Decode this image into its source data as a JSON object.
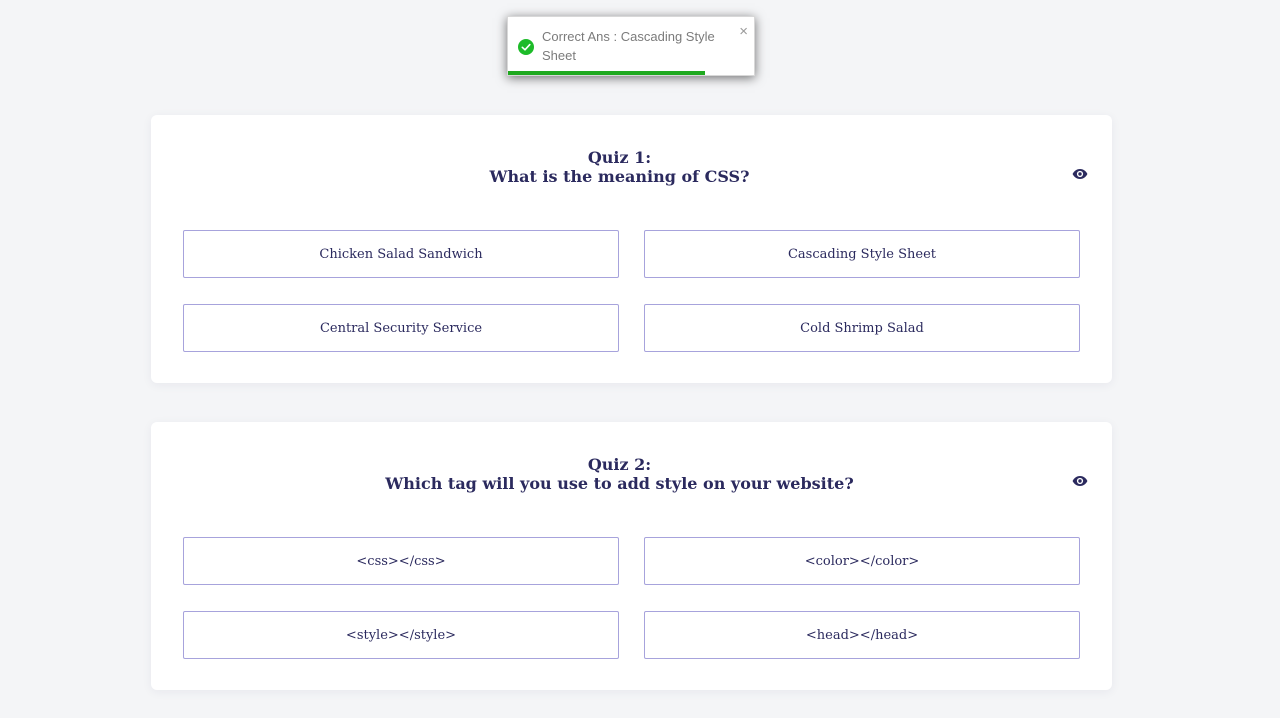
{
  "toast": {
    "message": "Correct Ans : Cascading Style Sheet",
    "close_symbol": "×",
    "status_icon": "check-circle-icon",
    "status_color": "#1dbb29",
    "progress": 0.8
  },
  "quizzes": [
    {
      "number_label": "Quiz 1:",
      "question": "What is the meaning of CSS?",
      "reveal_icon": "eye-icon",
      "options": [
        "Chicken Salad Sandwich",
        "Cascading Style Sheet",
        "Central Security Service",
        "Cold Shrimp Salad"
      ]
    },
    {
      "number_label": "Quiz 2:",
      "question": "Which tag will you use to add style on your website?",
      "reveal_icon": "eye-icon",
      "options": [
        "<css></css>",
        "<color></color>",
        "<style></style>",
        "<head></head>"
      ]
    }
  ],
  "colors": {
    "accent_text": "#2b2a5e",
    "option_border": "#a7a3dc",
    "page_background": "#f4f5f7"
  }
}
